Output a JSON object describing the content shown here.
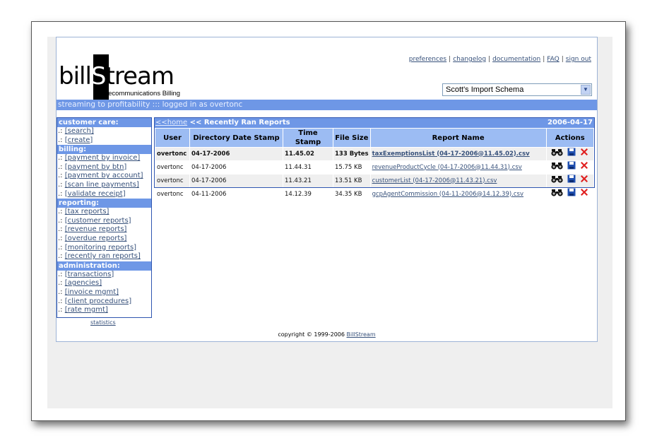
{
  "header": {
    "logo_text_before": "bill",
    "logo_text_s": "S",
    "logo_text_after": "tream",
    "logo_subtitle": "Telecommunications Billing",
    "links": [
      "preferences",
      "changelog",
      "documentation",
      "FAQ",
      "sign out"
    ],
    "schema_select": "Scott's Import Schema",
    "tagline": "streaming to profitability ::: logged in as overtonc"
  },
  "sidebar": {
    "prefix": ".:",
    "sections": [
      {
        "title": "customer care:",
        "items": [
          "[search]",
          "[create]"
        ]
      },
      {
        "title": "billing:",
        "items": [
          "[payment by invoice]",
          "[payment by btn]",
          "[payment by account]",
          "[scan line payments]",
          "[validate receipt]"
        ]
      },
      {
        "title": "reporting:",
        "items": [
          "[tax reports]",
          "[customer reports]",
          "[revenue reports]",
          "[overdue reports]",
          "[monitoring reports]",
          "[recently ran reports]"
        ]
      },
      {
        "title": "administration:",
        "items": [
          "[transactions]",
          "[agencies]",
          "[invoice mgmt]",
          "[client procedures]",
          "[rate mgmt]"
        ]
      }
    ],
    "statistics": "statistics"
  },
  "panel": {
    "home_link": "<<home",
    "title": "<< Recently Ran Reports",
    "date": "2006-04-17",
    "columns": [
      "User",
      "Directory Date Stamp",
      "Time Stamp",
      "File Size",
      "Report Name",
      "Actions"
    ],
    "rows": [
      {
        "user": "overtonc",
        "date": "04-17-2006",
        "time": "11.45.02",
        "size": "133 Bytes",
        "report": "taxExemptionsList (04-17-2006@11.45.02).csv",
        "bold": true
      },
      {
        "user": "overtonc",
        "date": "04-17-2006",
        "time": "11.44.31",
        "size": "15.75 KB",
        "report": "revenueProductCycle (04-17-2006@11.44.31).csv",
        "bold": false
      },
      {
        "user": "overtonc",
        "date": "04-17-2006",
        "time": "11.43.21",
        "size": "13.51 KB",
        "report": "customerList (04-17-2006@11.43.21).csv",
        "bold": false
      },
      {
        "user": "overtonc",
        "date": "04-11-2006",
        "time": "14.12.39",
        "size": "34.35 KB",
        "report": "gcpAgentCommission (04-11-2006@14.12.39).csv",
        "bold": false
      }
    ],
    "action_icons": [
      "binoculars-icon",
      "save-icon",
      "delete-icon"
    ]
  },
  "footer": {
    "copyright": "copyright © 1999-2006",
    "brand": "BillStream"
  },
  "colors": {
    "accent": "#6e97e6",
    "header_cell": "#9cbcf3",
    "border": "#2f56b0",
    "link": "#36507a",
    "delete": "#e02020",
    "save": "#1f4fb0"
  }
}
